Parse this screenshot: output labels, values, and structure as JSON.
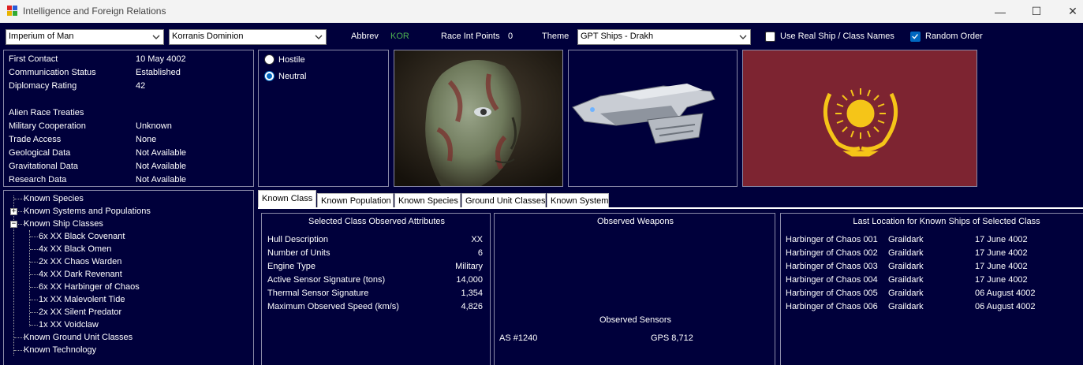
{
  "window": {
    "title": "Intelligence and Foreign Relations",
    "minimize": "—",
    "maximize": "☐",
    "close": "✕"
  },
  "toolbar": {
    "race_select": "Imperium of Man",
    "alien_select": "Korranis Dominion",
    "abbrev_label": "Abbrev",
    "abbrev_value": "KOR",
    "race_int_label": "Race Int Points",
    "race_int_value": "0",
    "theme_label": "Theme",
    "theme_select": "GPT Ships - Drakh",
    "real_names_label": "Use Real Ship / Class Names",
    "real_names_checked": false,
    "random_order_label": "Random Order",
    "random_order_checked": true
  },
  "info": {
    "first_contact_label": "First Contact",
    "first_contact_value": "10 May 4002",
    "comm_status_label": "Communication Status",
    "comm_status_value": "Established",
    "diplomacy_label": "Diplomacy Rating",
    "diplomacy_value": "42",
    "treaties_label": "Alien Race Treaties",
    "military_label": "Military Cooperation",
    "military_value": "Unknown",
    "trade_label": "Trade Access",
    "trade_value": "None",
    "geo_label": "Geological Data",
    "geo_value": "Not Available",
    "grav_label": "Gravitational Data",
    "grav_value": "Not Available",
    "research_label": "Research Data",
    "research_value": "Not Available"
  },
  "stance": {
    "hostile": "Hostile",
    "neutral": "Neutral",
    "selected": "Neutral"
  },
  "tree": {
    "known_species": "Known Species",
    "known_systems": "Known Systems and Populations",
    "known_ship_classes": "Known Ship Classes",
    "ship_classes": [
      "6x XX Black Covenant",
      "4x XX Black Omen",
      "2x XX Chaos Warden",
      "4x XX Dark Revenant",
      "6x XX Harbinger of Chaos",
      "1x XX Malevolent Tide",
      "2x XX Silent Predator",
      "1x XX Voidclaw"
    ],
    "known_ground": "Known Ground Unit Classes",
    "known_tech": "Known Technology"
  },
  "tabs": [
    "Known Class",
    "Known Population",
    "Known Species",
    "Ground Unit Classes",
    "Known System"
  ],
  "class_attrs": {
    "title": "Selected Class Observed Attributes",
    "rows": [
      {
        "label": "Hull Description",
        "value": "XX"
      },
      {
        "label": "Number of Units",
        "value": "6"
      },
      {
        "label": "Engine Type",
        "value": "Military"
      },
      {
        "label": "Active Sensor Signature (tons)",
        "value": "14,000"
      },
      {
        "label": "Thermal Sensor Signature",
        "value": "1,354"
      },
      {
        "label": "Maximum Observed Speed (km/s)",
        "value": "4,826"
      }
    ]
  },
  "weapons": {
    "title": "Observed Weapons",
    "sensors_title": "Observed Sensors",
    "sensor_a": "AS #1240",
    "sensor_b": "GPS 8,712"
  },
  "locations": {
    "title": "Last Location for Known Ships of Selected Class",
    "rows": [
      {
        "ship": "Harbinger of Chaos 001",
        "system": "Graildark",
        "date": "17 June 4002"
      },
      {
        "ship": "Harbinger of Chaos 002",
        "system": "Graildark",
        "date": "17 June 4002"
      },
      {
        "ship": "Harbinger of Chaos 003",
        "system": "Graildark",
        "date": "17 June 4002"
      },
      {
        "ship": "Harbinger of Chaos 004",
        "system": "Graildark",
        "date": "17 June 4002"
      },
      {
        "ship": "Harbinger of Chaos 005",
        "system": "Graildark",
        "date": "06 August 4002"
      },
      {
        "ship": "Harbinger of Chaos 006",
        "system": "Graildark",
        "date": "06 August 4002"
      }
    ]
  },
  "colors": {
    "background": "#00003b",
    "abbrev": "#4caf50",
    "flag": "#7d2431",
    "emblem": "#f5c518"
  }
}
